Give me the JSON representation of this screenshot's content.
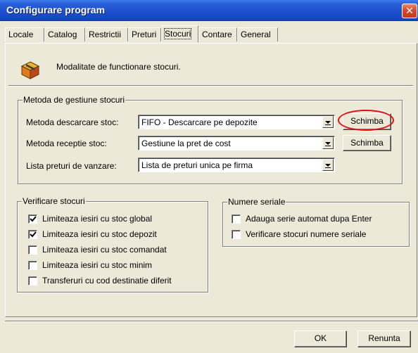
{
  "window": {
    "title": "Configurare program",
    "close_label": "✕"
  },
  "tabs": [
    {
      "label": "Locale",
      "active": false
    },
    {
      "label": "Catalog",
      "active": false
    },
    {
      "label": "Restrictii",
      "active": false
    },
    {
      "label": "Preturi",
      "active": false
    },
    {
      "label": "Stocuri",
      "active": true
    },
    {
      "label": "Contare",
      "active": false
    },
    {
      "label": "General",
      "active": false
    }
  ],
  "header": {
    "description": "Modalitate de functionare stocuri.",
    "icon": "box-icon"
  },
  "stock_method_group": {
    "title": "Metoda de gestiune stocuri",
    "rows": [
      {
        "label": "Metoda descarcare stoc:",
        "value": "FIFO - Descarcare pe depozite",
        "button": "Schimba"
      },
      {
        "label": "Metoda receptie stoc:",
        "value": "Gestiune la pret de cost",
        "button": "Schimba"
      },
      {
        "label": "Lista preturi de vanzare:",
        "value": "Lista de preturi unica pe firma"
      }
    ]
  },
  "stock_check_group": {
    "title": "Verificare stocuri",
    "items": [
      {
        "label": "Limiteaza iesiri cu stoc global",
        "checked": true
      },
      {
        "label": "Limiteaza iesiri cu stoc depozit",
        "checked": true
      },
      {
        "label": "Limiteaza iesiri cu stoc comandat",
        "checked": false
      },
      {
        "label": "Limiteaza iesiri cu stoc minim",
        "checked": false
      },
      {
        "label": "Transferuri cu cod destinatie diferit",
        "checked": false
      }
    ]
  },
  "serial_group": {
    "title": "Numere seriale",
    "items": [
      {
        "label": "Adauga serie automat dupa Enter",
        "checked": false
      },
      {
        "label": "Verificare stocuri numere seriale",
        "checked": false
      }
    ]
  },
  "footer": {
    "ok_label": "OK",
    "cancel_label": "Renunta"
  },
  "colors": {
    "title_bar": "#1e52d0",
    "dialog_bg": "#ece9d8",
    "highlight": "#e01010",
    "close_button": "#d4492a"
  }
}
